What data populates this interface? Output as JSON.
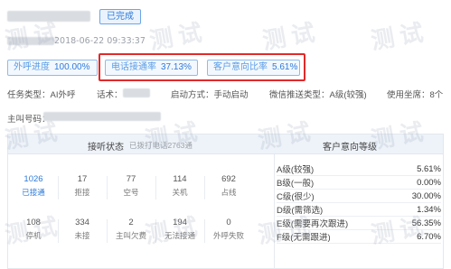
{
  "header": {
    "status_badge": "已完成",
    "created_time": "2018-06-22 09:33:37"
  },
  "progress": {
    "outbound_label": "外呼进度",
    "outbound_value": "100.00%",
    "call_label": "电话接通率",
    "call_value": "37.13%",
    "intent_label": "客户意向比率",
    "intent_value": "5.61%"
  },
  "info": {
    "task_type": "任务类型：AI外呼",
    "script": "话术：",
    "start_mode": "启动方式：手动启动",
    "wechat_push": "微信推送类型：A级(较强)",
    "seats": "使用坐席：8个"
  },
  "caller": {
    "label": "主叫号码："
  },
  "panel": {
    "answer_title": "接听状态",
    "answer_sub": "已拨打电话2763通",
    "intent_title": "客户意向等级"
  },
  "stats_row1": [
    {
      "num": "1026",
      "label": "已接通",
      "blue": true
    },
    {
      "num": "17",
      "label": "拒接",
      "blue": false
    },
    {
      "num": "77",
      "label": "空号",
      "blue": false
    },
    {
      "num": "114",
      "label": "关机",
      "blue": false
    },
    {
      "num": "692",
      "label": "占线",
      "blue": false
    }
  ],
  "stats_row2": [
    {
      "num": "108",
      "label": "停机",
      "blue": false
    },
    {
      "num": "334",
      "label": "未接",
      "blue": false
    },
    {
      "num": "2",
      "label": "主叫欠费",
      "blue": false
    },
    {
      "num": "194",
      "label": "无法接通",
      "blue": false
    },
    {
      "num": "0",
      "label": "外呼失败",
      "blue": false
    }
  ],
  "intent_levels": [
    {
      "label": "A级(较强)",
      "pct": "5.61%"
    },
    {
      "label": "B级(一般)",
      "pct": "0.00%"
    },
    {
      "label": "C级(很少)",
      "pct": "30.00%"
    },
    {
      "label": "D级(需筛选)",
      "pct": "1.34%"
    },
    {
      "label": "E级(需要再次跟进)",
      "pct": "56.35%"
    },
    {
      "label": "F级(无需跟进)",
      "pct": "6.70%"
    }
  ],
  "watermark": "测试",
  "colors": {
    "accent": "#2f7bd8",
    "highlight": "#e02a2a",
    "panel_header": "#eef3f9"
  }
}
